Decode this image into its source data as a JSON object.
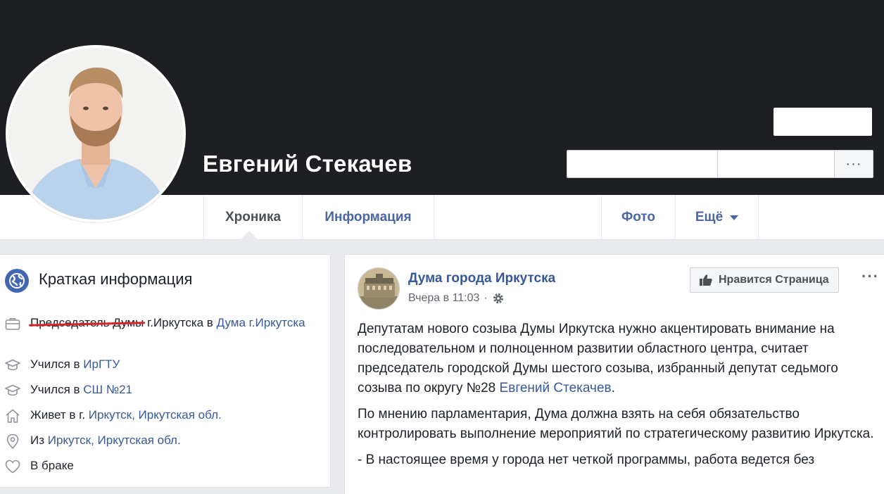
{
  "profile": {
    "name": "Евгений Стекачев",
    "more_label": "···"
  },
  "tabs": [
    {
      "label": "Хроника"
    },
    {
      "label": "Информация"
    },
    {
      "label": "Фото"
    },
    {
      "label": "Ещё"
    }
  ],
  "intro": {
    "title": "Краткая информация",
    "work": {
      "struck": "Председатель Думы",
      "middle": " г.Иркутска в ",
      "link": "Дума г.Иркутска"
    },
    "edu1": {
      "prefix": "Учился в ",
      "link": "ИрГТУ"
    },
    "edu2": {
      "prefix": "Учился в ",
      "link": "СШ №21"
    },
    "lives": {
      "prefix": "Живет в г. ",
      "link": "Иркутск, Иркутская обл."
    },
    "from": {
      "prefix": "Из ",
      "link": "Иркутск, Иркутская обл."
    },
    "relationship": "В браке"
  },
  "post": {
    "page_name": "Дума города Иркутска",
    "time": "Вчера в 11:03",
    "separator": "·",
    "like_button": "Нравится Страница",
    "more": "···",
    "p1_text": "Депутатам нового созыва Думы Иркутска нужно акцентировать внимание на последовательном и полноценном развитии областного центра, считает председатель городской Думы шестого созыва, избранный депутат седьмого созыва по округу №28 ",
    "p1_link": "Евгений Стекачев",
    "p1_end": ".",
    "p2": "По мнению парламентария, Дума должна взять на себя обязательство контролировать выполнение мероприятий по стратегическому развитию Иркутска.",
    "p3": "- В настоящее время у города нет четкой программы, работа ведется без"
  },
  "colors": {
    "cover": "#1e1f22",
    "link": "#385898",
    "strike": "#d6252a",
    "background": "#e9ebee"
  }
}
